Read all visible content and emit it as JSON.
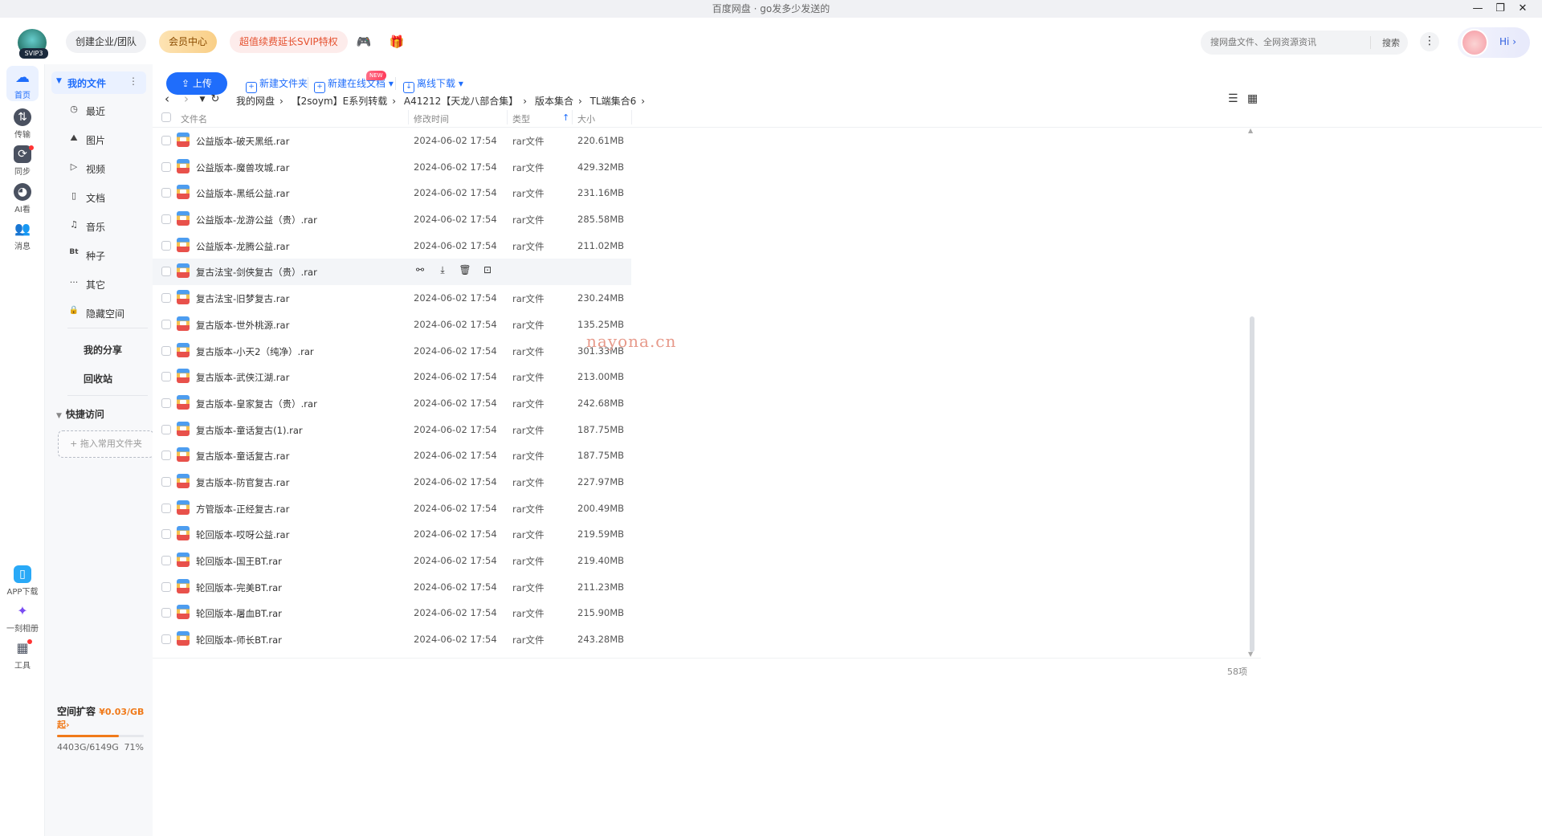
{
  "window": {
    "title": "百度网盘 · go发多少发送的",
    "controls": {
      "minimize": "—",
      "restore": "❐",
      "close": "✕"
    }
  },
  "topbar": {
    "logo_badge": "SVIP3",
    "create_team": "创建企业/团队",
    "member_center": "会员中心",
    "svip_promo": "超值续费延长SVIP特权",
    "game_icon": "🎮",
    "gift_icon": "🎁",
    "search_placeholder": "搜网盘文件、全网资源资讯",
    "search_button": "搜索",
    "more": "⋮",
    "greeting": "Hi",
    "greeting_arrow": "›"
  },
  "rail": {
    "items": [
      {
        "label": "首页",
        "icon": "cloud-icon"
      },
      {
        "label": "传输",
        "icon": "transfer-icon"
      },
      {
        "label": "同步",
        "icon": "sync-icon"
      },
      {
        "label": "AI看",
        "icon": "ai-icon"
      },
      {
        "label": "消息",
        "icon": "message-icon"
      }
    ],
    "bottom": [
      {
        "label": "APP下载"
      },
      {
        "label": "一刻相册"
      },
      {
        "label": "工具"
      }
    ]
  },
  "sidebar": {
    "my_files": "我的文件",
    "menu_dots": "⋮",
    "items": [
      {
        "label": "最近",
        "glyph": "◷"
      },
      {
        "label": "图片",
        "glyph": "⛰"
      },
      {
        "label": "视频",
        "glyph": "▷"
      },
      {
        "label": "文档",
        "glyph": "▯"
      },
      {
        "label": "音乐",
        "glyph": "♫"
      },
      {
        "label": "种子",
        "glyph": "Bt"
      },
      {
        "label": "其它",
        "glyph": "···"
      },
      {
        "label": "隐藏空间",
        "glyph": "🔒"
      }
    ],
    "my_share": "我的分享",
    "recycle": "回收站",
    "quick_access": "快捷访问",
    "drop_hint": "+ 拖入常用文件夹",
    "storage_title": "空间扩容",
    "storage_price": "¥0.03/GB起",
    "storage_used": "4403G/6149G",
    "storage_percent": "71%",
    "storage_fraction": 0.71
  },
  "toolbar": {
    "upload": "上传",
    "new_folder": "新建文件夹",
    "new_doc": "新建在线文档",
    "new_badge": "NEW",
    "offline_download": "离线下载"
  },
  "nav": {
    "breadcrumbs": [
      "我的网盘",
      "【2soym】E系列转载",
      "A41212【天龙八部合集】",
      "版本集合",
      "TL端集合6"
    ]
  },
  "table": {
    "headers": {
      "name": "文件名",
      "modified": "修改时间",
      "type": "类型",
      "size": "大小"
    },
    "sort_arrow": "↑",
    "rows": [
      {
        "name": "公益版本-破天黑纸.rar",
        "time": "2024-06-02 17:54",
        "type": "rar文件",
        "size": "220.61MB"
      },
      {
        "name": "公益版本-魔兽攻城.rar",
        "time": "2024-06-02 17:54",
        "type": "rar文件",
        "size": "429.32MB"
      },
      {
        "name": "公益版本-黑纸公益.rar",
        "time": "2024-06-02 17:54",
        "type": "rar文件",
        "size": "231.16MB"
      },
      {
        "name": "公益版本-龙游公益（贵）.rar",
        "time": "2024-06-02 17:54",
        "type": "rar文件",
        "size": "285.58MB"
      },
      {
        "name": "公益版本-龙腾公益.rar",
        "time": "2024-06-02 17:54",
        "type": "rar文件",
        "size": "211.02MB"
      },
      {
        "name": "复古法宝-剑侠复古（贵）.rar",
        "time": "",
        "type": "",
        "size": "",
        "hover": true
      },
      {
        "name": "复古法宝-旧梦复古.rar",
        "time": "2024-06-02 17:54",
        "type": "rar文件",
        "size": "230.24MB"
      },
      {
        "name": "复古版本-世外桃源.rar",
        "time": "2024-06-02 17:54",
        "type": "rar文件",
        "size": "135.25MB"
      },
      {
        "name": "复古版本-小天2（纯净）.rar",
        "time": "2024-06-02 17:54",
        "type": "rar文件",
        "size": "301.33MB"
      },
      {
        "name": "复古版本-武侠江湖.rar",
        "time": "2024-06-02 17:54",
        "type": "rar文件",
        "size": "213.00MB"
      },
      {
        "name": "复古版本-皇家复古（贵）.rar",
        "time": "2024-06-02 17:54",
        "type": "rar文件",
        "size": "242.68MB"
      },
      {
        "name": "复古版本-童话复古(1).rar",
        "time": "2024-06-02 17:54",
        "type": "rar文件",
        "size": "187.75MB"
      },
      {
        "name": "复古版本-童话复古.rar",
        "time": "2024-06-02 17:54",
        "type": "rar文件",
        "size": "187.75MB"
      },
      {
        "name": "复古版本-防官复古.rar",
        "time": "2024-06-02 17:54",
        "type": "rar文件",
        "size": "227.97MB"
      },
      {
        "name": "方管版本-正经复古.rar",
        "time": "2024-06-02 17:54",
        "type": "rar文件",
        "size": "200.49MB"
      },
      {
        "name": "轮回版本-哎呀公益.rar",
        "time": "2024-06-02 17:54",
        "type": "rar文件",
        "size": "219.59MB"
      },
      {
        "name": "轮回版本-国王BT.rar",
        "time": "2024-06-02 17:54",
        "type": "rar文件",
        "size": "219.40MB"
      },
      {
        "name": "轮回版本-完美BT.rar",
        "time": "2024-06-02 17:54",
        "type": "rar文件",
        "size": "211.23MB"
      },
      {
        "name": "轮回版本-屠血BT.rar",
        "time": "2024-06-02 17:54",
        "type": "rar文件",
        "size": "215.90MB"
      },
      {
        "name": "轮回版本-师长BT.rar",
        "time": "2024-06-02 17:54",
        "type": "rar文件",
        "size": "243.28MB"
      }
    ],
    "hover_actions": [
      "share-icon",
      "download-icon",
      "delete-icon",
      "more-icon"
    ],
    "item_count": "58项"
  },
  "watermark": "nayona.cn",
  "colors": {
    "accent": "#1f6dfb",
    "storage": "#f07a1a",
    "promo": "#e5512f"
  }
}
